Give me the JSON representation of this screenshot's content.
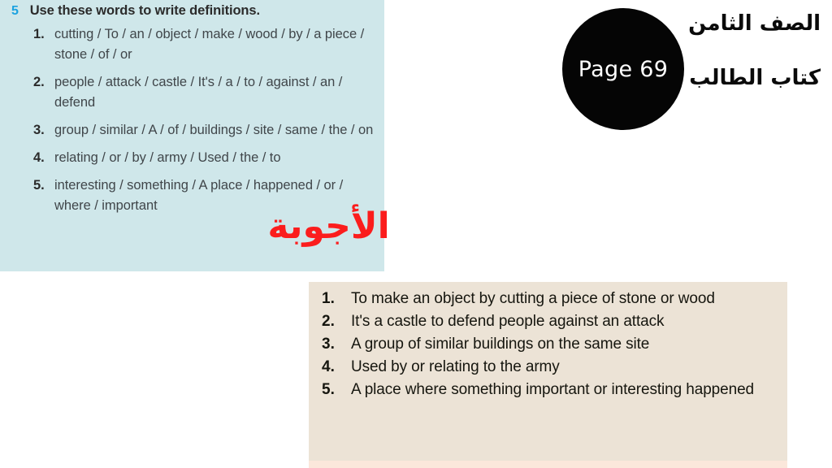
{
  "exercise": {
    "number": "5",
    "title": "Use these words to write definitions.",
    "items": [
      {
        "num": "1.",
        "text": "cutting / To / an / object / make / wood / by / a piece / stone / of / or"
      },
      {
        "num": "2.",
        "text": "people / attack / castle / It's / a / to / against / an / defend"
      },
      {
        "num": "3.",
        "text": "group / similar / A / of / buildings / site / same / the / on"
      },
      {
        "num": "4.",
        "text": "relating / or / by / army / Used / the / to"
      },
      {
        "num": "5.",
        "text": "interesting / something / A place / happened / or / where / important"
      }
    ],
    "background_color": "#cfe7ea",
    "number_color": "#1ba2e0"
  },
  "page_badge": {
    "label": "Page 69",
    "background_color": "#050505",
    "text_color": "#ffffff"
  },
  "arabic_header": {
    "grade": "الصف الثامن",
    "book": "كتاب الطالب",
    "color": "#0a0a0a"
  },
  "answers_heading": {
    "text": "الأجوبة",
    "color": "#fb1d1d"
  },
  "answers": {
    "background_color": "#ece3d6",
    "items": [
      {
        "num": "1.",
        "text": "To make an object by cutting a piece of stone or wood"
      },
      {
        "num": "2.",
        "text": "It's a castle to defend people against an attack"
      },
      {
        "num": "3.",
        "text": "A group of similar buildings on the same site"
      },
      {
        "num": "4.",
        "text": "Used by or relating to the army"
      },
      {
        "num": "5.",
        "text": "A place where something important or interesting happened"
      }
    ]
  }
}
